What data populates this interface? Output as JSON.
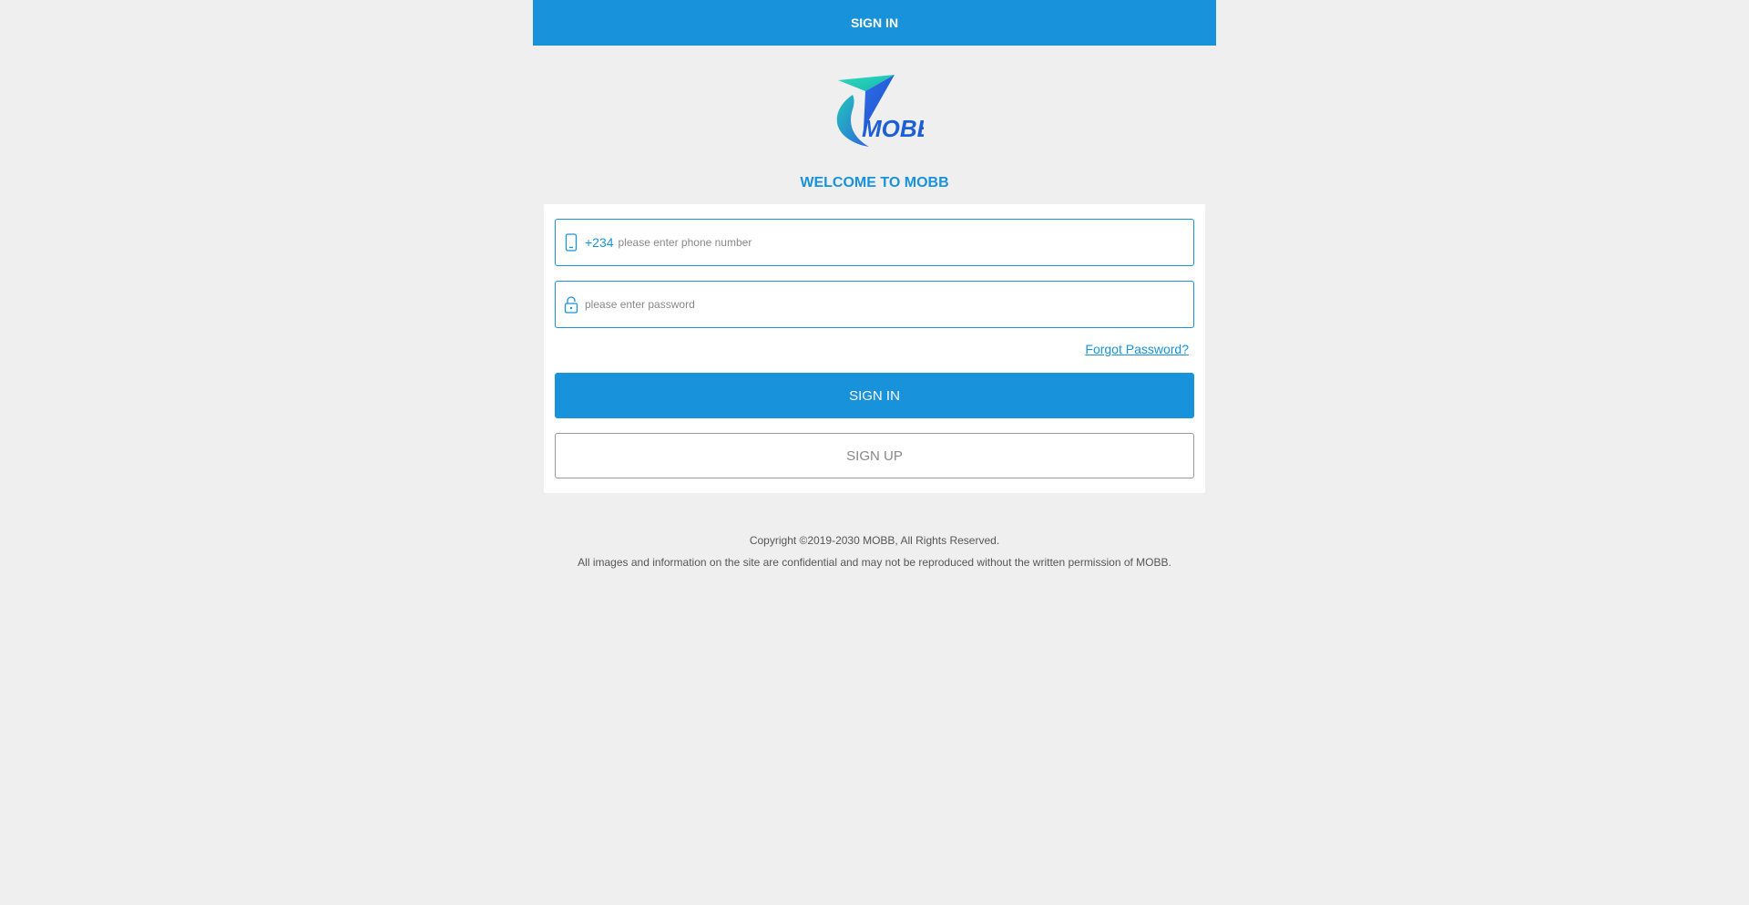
{
  "header": {
    "title": "SIGN IN",
    "background_color": "#1892db"
  },
  "brand": {
    "logo_text": "MOBB",
    "logo_icon": "paper-plane-logo"
  },
  "welcome": {
    "text": "WELCOME TO MOBB"
  },
  "login_form": {
    "phone": {
      "icon": "mobile-phone-icon",
      "country_code": "+234",
      "value": "",
      "placeholder": "please enter phone number"
    },
    "password": {
      "icon": "lock-icon",
      "value": "",
      "placeholder": "please enter password"
    },
    "forgot_password_label": "Forgot Password?",
    "sign_in_label": "SIGN IN",
    "sign_up_label": "SIGN UP"
  },
  "footer": {
    "copyright": "Copyright ©2019-2030 MOBB, All Rights Reserved.",
    "notice": "All images and information on the site are confidential and may not be reproduced without the written permission of MOBB."
  },
  "colors": {
    "accent": "#1892db",
    "page_background": "#efefef",
    "card_background": "#ffffff"
  }
}
